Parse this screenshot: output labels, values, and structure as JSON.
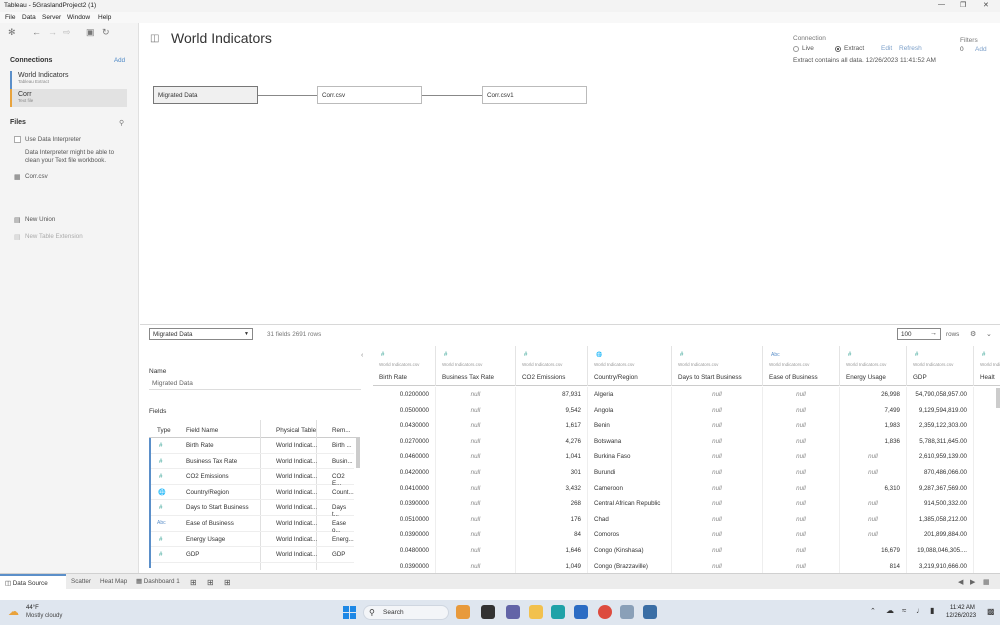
{
  "window": {
    "title": "Tableau - 5GraslandProject2 (1)"
  },
  "menu": [
    "File",
    "Data",
    "Server",
    "Window",
    "Help"
  ],
  "left": {
    "connections_title": "Connections",
    "add": "Add",
    "connections": [
      {
        "name": "World Indicators",
        "sub": "Tableau Extract"
      },
      {
        "name": "Corr",
        "sub": "Text file"
      }
    ],
    "files_title": "Files",
    "use_interpreter": "Use Data Interpreter",
    "interpreter_note": [
      "Data Interpreter might be able to",
      "clean your Text file workbook."
    ],
    "file": "Corr.csv",
    "new_union": "New Union",
    "new_table_ext": "New Table Extension"
  },
  "datasource": {
    "title": "World Indicators",
    "connection_label": "Connection",
    "live": "Live",
    "extract": "Extract",
    "edit": "Edit",
    "refresh": "Refresh",
    "extract_note": "Extract contains all data. 12/26/2023 11:41:52 AM",
    "filters_label": "Filters",
    "filters_count": "0",
    "filters_add": "Add"
  },
  "nodes": [
    "Migrated Data",
    "Corr.csv",
    "Corr.csv1"
  ],
  "mid": {
    "table_select": "Migrated Data",
    "summary": "31 fields 2691 rows",
    "rows_value": "100",
    "rows_label": "rows"
  },
  "meta": {
    "name_label": "Name",
    "name_value": "Migrated Data",
    "fields_label": "Fields",
    "headers": [
      "Type",
      "Field Name",
      "Physical Table",
      "Rem..."
    ],
    "rows": [
      {
        "type": "#",
        "name": "Birth Rate",
        "table": "World Indicat...",
        "rem": "Birth ..."
      },
      {
        "type": "#",
        "name": "Business Tax Rate",
        "table": "World Indicat...",
        "rem": "Busin..."
      },
      {
        "type": "#",
        "name": "CO2 Emissions",
        "table": "World Indicat...",
        "rem": "CO2 E..."
      },
      {
        "type": "globe",
        "name": "Country/Region",
        "table": "World Indicat...",
        "rem": "Count..."
      },
      {
        "type": "#",
        "name": "Days to Start Business",
        "table": "World Indicat...",
        "rem": "Days t..."
      },
      {
        "type": "Abc",
        "name": "Ease of Business",
        "table": "World Indicat...",
        "rem": "Ease o..."
      },
      {
        "type": "#",
        "name": "Energy Usage",
        "table": "World Indicat...",
        "rem": "Energ..."
      },
      {
        "type": "#",
        "name": "GDP",
        "table": "World Indicat...",
        "rem": "GDP"
      }
    ]
  },
  "grid": {
    "source": "World Indicators.csv",
    "columns": [
      {
        "name": "Birth Rate",
        "type": "#"
      },
      {
        "name": "Business Tax Rate",
        "type": "#"
      },
      {
        "name": "CO2 Emissions",
        "type": "#"
      },
      {
        "name": "Country/Region",
        "type": "globe"
      },
      {
        "name": "Days to Start Business",
        "type": "#"
      },
      {
        "name": "Ease of Business",
        "type": "Abc"
      },
      {
        "name": "Energy Usage",
        "type": "#"
      },
      {
        "name": "GDP",
        "type": "#"
      },
      {
        "name": "Healt",
        "type": "#"
      }
    ],
    "rows": [
      [
        "0.0200000",
        "null",
        "87,931",
        "Algeria",
        "null",
        "null",
        "26,998",
        "54,790,058,957.00"
      ],
      [
        "0.0500000",
        "null",
        "9,542",
        "Angola",
        "null",
        "null",
        "7,499",
        "9,129,594,819.00"
      ],
      [
        "0.0430000",
        "null",
        "1,617",
        "Benin",
        "null",
        "null",
        "1,983",
        "2,359,122,303.00"
      ],
      [
        "0.0270000",
        "null",
        "4,276",
        "Botswana",
        "null",
        "null",
        "1,836",
        "5,788,311,645.00"
      ],
      [
        "0.0460000",
        "null",
        "1,041",
        "Burkina Faso",
        "null",
        "null",
        "null",
        "2,610,959,139.00"
      ],
      [
        "0.0420000",
        "null",
        "301",
        "Burundi",
        "null",
        "null",
        "null",
        "870,486,066.00"
      ],
      [
        "0.0410000",
        "null",
        "3,432",
        "Cameroon",
        "null",
        "null",
        "6,310",
        "9,287,367,569.00"
      ],
      [
        "0.0390000",
        "null",
        "268",
        "Central African Republic",
        "null",
        "null",
        "null",
        "914,500,332.00"
      ],
      [
        "0.0510000",
        "null",
        "176",
        "Chad",
        "null",
        "null",
        "null",
        "1,385,058,212.00"
      ],
      [
        "0.0390000",
        "null",
        "84",
        "Comoros",
        "null",
        "null",
        "null",
        "201,899,884.00"
      ],
      [
        "0.0480000",
        "null",
        "1,646",
        "Congo (Kinshasa)",
        "null",
        "null",
        "16,679",
        "19,088,046,305...."
      ],
      [
        "0.0390000",
        "null",
        "1,049",
        "Congo (Brazzaville)",
        "null",
        "null",
        "814",
        "3,219,910,666.00"
      ]
    ]
  },
  "tabs": [
    "Data Source",
    "Scatter",
    "Heat Map",
    "Dashboard 1"
  ],
  "taskbar": {
    "temp": "44°F",
    "weather": "Mostly cloudy",
    "search": "Search",
    "time": "11:42 AM",
    "date": "12/26/2023"
  }
}
